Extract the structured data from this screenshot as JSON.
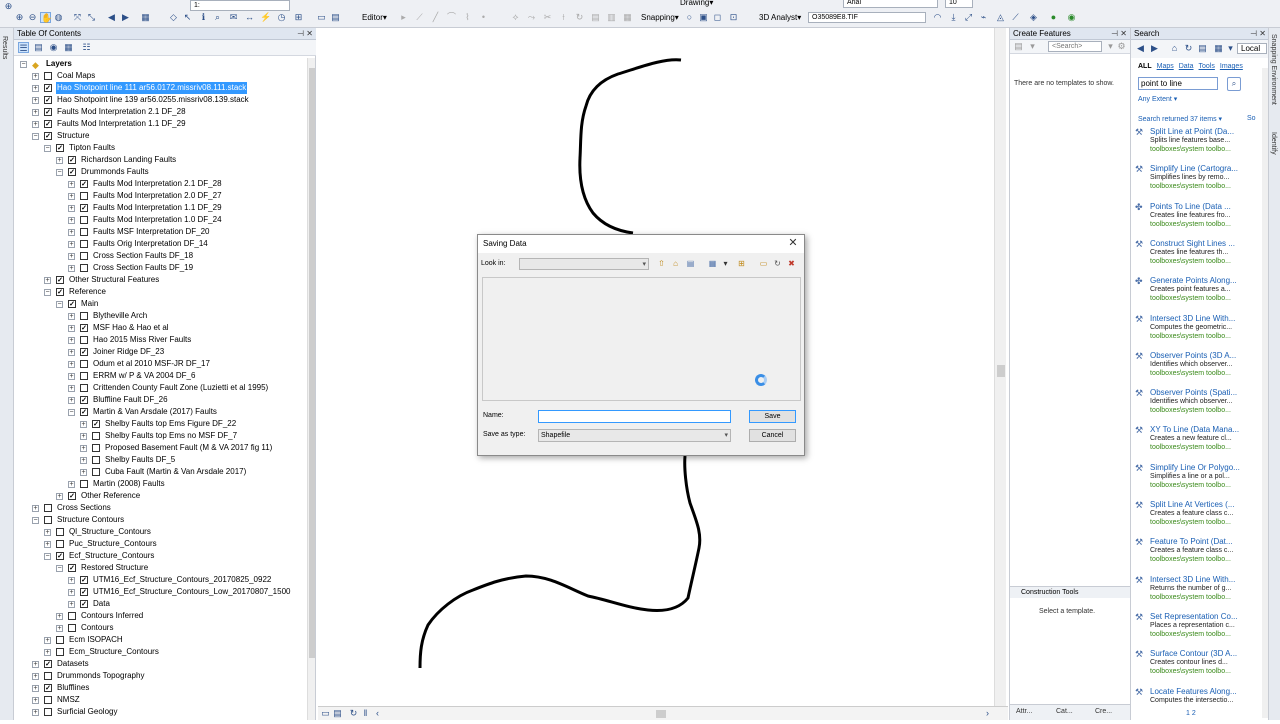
{
  "toolbar": {
    "scale": "1:",
    "editor": "Editor▾",
    "snapping": "Snapping▾",
    "analyst": "3D Analyst▾",
    "layer": "O35089E8.TIF",
    "font": "Arial",
    "fontsize": "10",
    "drawing": "Drawing▾"
  },
  "toc": {
    "title": "Table Of Contents",
    "nodes": [
      {
        "text": "Layers",
        "exp": "−",
        "cb": null,
        "d": 0
      },
      {
        "text": "Coal Maps",
        "exp": "+",
        "cb": false,
        "d": 1
      },
      {
        "text": "Hao Shotpoint line 111 ar56.0172.missriv08.111.stack",
        "exp": "+",
        "cb": true,
        "d": 1,
        "sel": true
      },
      {
        "text": "Hao Shotpoint line 139 ar56.0255.missriv08.139.stack",
        "exp": "+",
        "cb": true,
        "d": 1
      },
      {
        "text": "Faults Mod Interpretation 2.1 DF_28",
        "exp": "+",
        "cb": true,
        "d": 1
      },
      {
        "text": "Faults Mod Interpretation 1.1 DF_29",
        "exp": "+",
        "cb": true,
        "d": 1
      },
      {
        "text": "Structure",
        "exp": "−",
        "cb": true,
        "d": 1
      },
      {
        "text": "Tipton Faults",
        "exp": "−",
        "cb": true,
        "d": 2
      },
      {
        "text": "Richardson Landing Faults",
        "exp": "+",
        "cb": true,
        "d": 3
      },
      {
        "text": "Drummonds Faults",
        "exp": "−",
        "cb": true,
        "d": 3
      },
      {
        "text": "Faults Mod Interpretation 2.1 DF_28",
        "exp": "+",
        "cb": true,
        "d": 4
      },
      {
        "text": "Faults Mod Interpretation 2.0 DF_27",
        "exp": "+",
        "cb": false,
        "d": 4
      },
      {
        "text": "Faults Mod Interpretation 1.1 DF_29",
        "exp": "+",
        "cb": true,
        "d": 4
      },
      {
        "text": "Faults Mod Interpretation 1.0 DF_24",
        "exp": "+",
        "cb": false,
        "d": 4
      },
      {
        "text": "Faults MSF Interpretation DF_20",
        "exp": "+",
        "cb": false,
        "d": 4
      },
      {
        "text": "Faults Orig Interpretation DF_14",
        "exp": "+",
        "cb": false,
        "d": 4
      },
      {
        "text": "Cross Section Faults DF_18",
        "exp": "+",
        "cb": false,
        "d": 4
      },
      {
        "text": "Cross Section Faults DF_19",
        "exp": "+",
        "cb": false,
        "d": 4
      },
      {
        "text": "Other Structural Features",
        "exp": "+",
        "cb": true,
        "d": 2
      },
      {
        "text": "Reference",
        "exp": "−",
        "cb": true,
        "d": 2
      },
      {
        "text": "Main",
        "exp": "−",
        "cb": true,
        "d": 3
      },
      {
        "text": "Blytheville Arch",
        "exp": "+",
        "cb": false,
        "d": 4
      },
      {
        "text": "MSF Hao & Hao et al",
        "exp": "+",
        "cb": true,
        "d": 4
      },
      {
        "text": "Hao 2015 Miss River Faults",
        "exp": "+",
        "cb": false,
        "d": 4
      },
      {
        "text": "Joiner Ridge DF_23",
        "exp": "+",
        "cb": true,
        "d": 4
      },
      {
        "text": "Odum et al 2010 MSF-JR DF_17",
        "exp": "+",
        "cb": false,
        "d": 4
      },
      {
        "text": "ERRM w/ P & VA 2004 DF_6",
        "exp": "+",
        "cb": false,
        "d": 4
      },
      {
        "text": "Crittenden County Fault Zone (Luzietti et al 1995)",
        "exp": "+",
        "cb": false,
        "d": 4
      },
      {
        "text": "Bluffline Fault DF_26",
        "exp": "+",
        "cb": true,
        "d": 4
      },
      {
        "text": "Martin & Van Arsdale (2017) Faults",
        "exp": "−",
        "cb": true,
        "d": 4
      },
      {
        "text": "Shelby Faults top Ems Figure DF_22",
        "exp": "+",
        "cb": true,
        "d": 5
      },
      {
        "text": "Shelby Faults top Ems no MSF DF_7",
        "exp": "+",
        "cb": false,
        "d": 5
      },
      {
        "text": "Proposed Basement Fault (M & VA 2017 fig 11)",
        "exp": "+",
        "cb": false,
        "d": 5
      },
      {
        "text": "Shelby Faults DF_5",
        "exp": "+",
        "cb": false,
        "d": 5
      },
      {
        "text": "Cuba Fault (Martin & Van Arsdale 2017)",
        "exp": "+",
        "cb": false,
        "d": 5
      },
      {
        "text": "Martin (2008) Faults",
        "exp": "+",
        "cb": false,
        "d": 4
      },
      {
        "text": "Other Reference",
        "exp": "+",
        "cb": true,
        "d": 3
      },
      {
        "text": "Cross Sections",
        "exp": "+",
        "cb": false,
        "d": 1
      },
      {
        "text": "Structure Contours",
        "exp": "−",
        "cb": false,
        "d": 1
      },
      {
        "text": "Ql_Structure_Contours",
        "exp": "+",
        "cb": false,
        "d": 2
      },
      {
        "text": "Puc_Structure_Contours",
        "exp": "+",
        "cb": false,
        "d": 2
      },
      {
        "text": "Ecf_Structure_Contours",
        "exp": "−",
        "cb": true,
        "d": 2
      },
      {
        "text": "Restored Structure",
        "exp": "−",
        "cb": true,
        "d": 3
      },
      {
        "text": "UTM16_Ecf_Structure_Contours_20170825_0922",
        "exp": "+",
        "cb": true,
        "d": 4
      },
      {
        "text": "UTM16_Ecf_Structure_Contours_Low_20170807_1500",
        "exp": "+",
        "cb": true,
        "d": 4
      },
      {
        "text": "Data",
        "exp": "+",
        "cb": true,
        "d": 4
      },
      {
        "text": "Contours Inferred",
        "exp": "+",
        "cb": false,
        "d": 3
      },
      {
        "text": "Contours",
        "exp": "+",
        "cb": false,
        "d": 3
      },
      {
        "text": "Ecm ISOPACH",
        "exp": "+",
        "cb": false,
        "d": 2
      },
      {
        "text": "Ecm_Structure_Contours",
        "exp": "+",
        "cb": false,
        "d": 2
      },
      {
        "text": "Datasets",
        "exp": "+",
        "cb": true,
        "d": 1
      },
      {
        "text": "Drummonds Topography",
        "exp": "+",
        "cb": false,
        "d": 1
      },
      {
        "text": "Blufflines",
        "exp": "+",
        "cb": true,
        "d": 1
      },
      {
        "text": "NMSZ",
        "exp": "+",
        "cb": false,
        "d": 1
      },
      {
        "text": "Surficial Geology",
        "exp": "+",
        "cb": false,
        "d": 1
      }
    ]
  },
  "dialog": {
    "title": "Saving Data",
    "look_in_label": "Look in:",
    "look_in_value": "",
    "name_label": "Name:",
    "name_value": "",
    "type_label": "Save as type:",
    "type_value": "Shapefile",
    "save": "Save",
    "cancel": "Cancel"
  },
  "create_features": {
    "title": "Create Features",
    "search_placeholder": "<Search>",
    "message": "There are no templates to show.",
    "construction_title": "Construction Tools",
    "construction_message": "Select a template.",
    "tabs": [
      "Attr...",
      "Cat...",
      "Cre..."
    ]
  },
  "search": {
    "title": "Search",
    "scope": "Local",
    "filters": [
      "ALL",
      "Maps",
      "Data",
      "Tools",
      "Images"
    ],
    "query": "point to line",
    "extent": "Any Extent ▾",
    "count": "Search returned 37 items ▾",
    "sort": "So",
    "results": [
      {
        "title": "Split Line at Point (Da...",
        "desc": "Splits line features base...",
        "path": "toolboxes\\system toolbo..."
      },
      {
        "title": "Simplify Line (Cartogra...",
        "desc": "Simplifies lines by remo...",
        "path": "toolboxes\\system toolbo..."
      },
      {
        "title": "Points To Line (Data ...",
        "desc": "Creates line features fro...",
        "path": "toolboxes\\system toolbo..."
      },
      {
        "title": "Construct Sight Lines ...",
        "desc": "Creates line features th...",
        "path": "toolboxes\\system toolbo..."
      },
      {
        "title": "Generate Points Along...",
        "desc": "Creates point features a...",
        "path": "toolboxes\\system toolbo..."
      },
      {
        "title": "Intersect 3D Line With...",
        "desc": "Computes the geometric...",
        "path": "toolboxes\\system toolbo..."
      },
      {
        "title": "Observer Points (3D A...",
        "desc": "Identifies which observer...",
        "path": "toolboxes\\system toolbo..."
      },
      {
        "title": "Observer Points (Spati...",
        "desc": "Identifies which observer...",
        "path": "toolboxes\\system toolbo..."
      },
      {
        "title": "XY To Line (Data Mana...",
        "desc": "Creates a new feature cl...",
        "path": "toolboxes\\system toolbo..."
      },
      {
        "title": "Simplify Line Or Polygo...",
        "desc": "Simplifies a line or a pol...",
        "path": "toolboxes\\system toolbo..."
      },
      {
        "title": "Split Line At Vertices (...",
        "desc": "Creates a feature class c...",
        "path": "toolboxes\\system toolbo..."
      },
      {
        "title": "Feature To Point (Dat...",
        "desc": "Creates a feature class c...",
        "path": "toolboxes\\system toolbo..."
      },
      {
        "title": "Intersect 3D Line With...",
        "desc": "Returns the number of g...",
        "path": "toolboxes\\system toolbo..."
      },
      {
        "title": "Set Representation Co...",
        "desc": "Places a representation c...",
        "path": "toolboxes\\system toolbo..."
      },
      {
        "title": "Surface Contour (3D A...",
        "desc": "Creates contour lines d...",
        "path": "toolboxes\\system toolbo..."
      },
      {
        "title": "Locate Features Along...",
        "desc": "Computes the intersectio...",
        "path": ""
      }
    ],
    "pages": "1 2"
  },
  "side_tabs": {
    "left": "Results",
    "right1": "Snapping Environment",
    "right2": "Identify"
  }
}
